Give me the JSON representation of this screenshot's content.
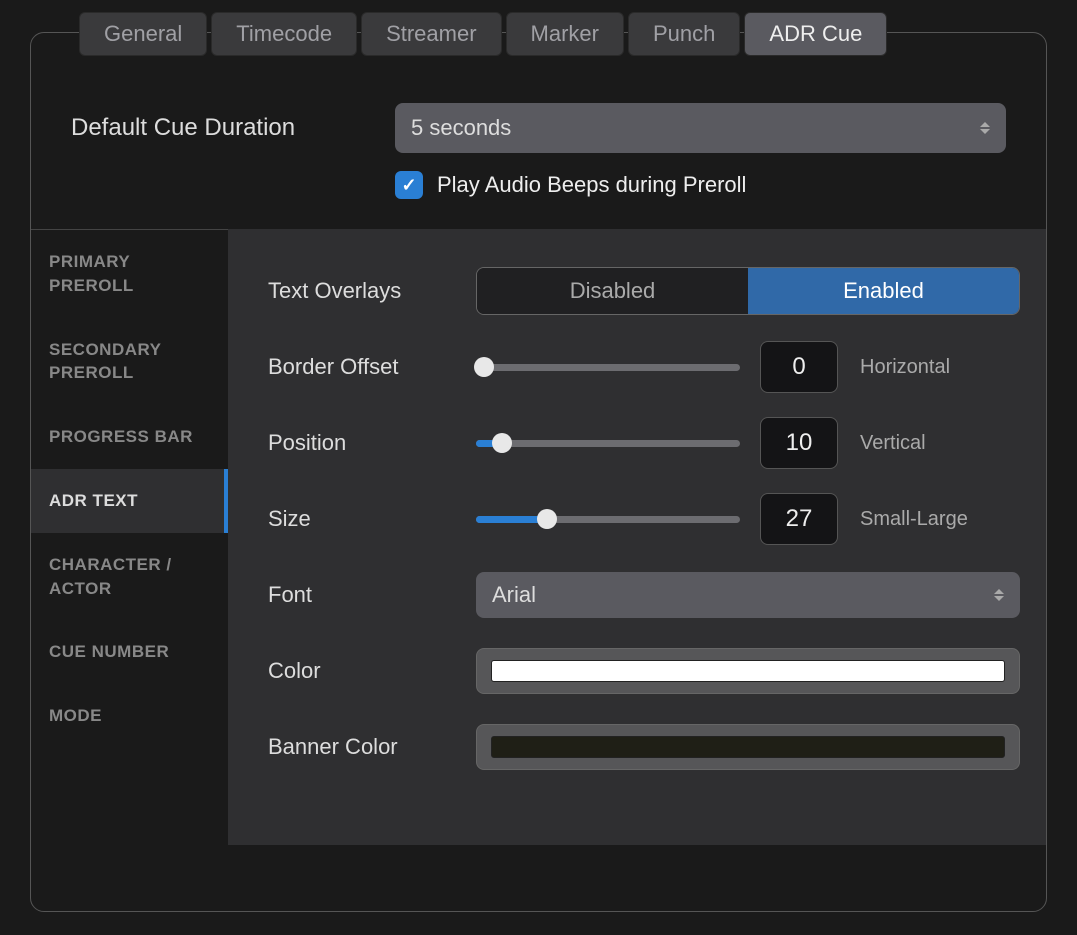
{
  "tabs": [
    {
      "label": "General",
      "active": false
    },
    {
      "label": "Timecode",
      "active": false
    },
    {
      "label": "Streamer",
      "active": false
    },
    {
      "label": "Marker",
      "active": false
    },
    {
      "label": "Punch",
      "active": false
    },
    {
      "label": "ADR Cue",
      "active": true
    }
  ],
  "default_cue_duration": {
    "label": "Default Cue Duration",
    "value": "5 seconds"
  },
  "play_beeps": {
    "label": "Play Audio Beeps during Preroll",
    "checked": true
  },
  "sidebar": [
    {
      "label": "PRIMARY PREROLL",
      "active": false
    },
    {
      "label": "SECONDARY PREROLL",
      "active": false
    },
    {
      "label": "PROGRESS BAR",
      "active": false
    },
    {
      "label": "ADR TEXT",
      "active": true
    },
    {
      "label": "CHARACTER / ACTOR",
      "active": false
    },
    {
      "label": "CUE NUMBER",
      "active": false
    },
    {
      "label": "MODE",
      "active": false
    }
  ],
  "detail": {
    "text_overlays": {
      "label": "Text Overlays",
      "options": [
        "Disabled",
        "Enabled"
      ],
      "selected": "Enabled"
    },
    "border_offset": {
      "label": "Border Offset",
      "value": 0,
      "min": 0,
      "max": 100,
      "suffix": "Horizontal"
    },
    "position": {
      "label": "Position",
      "value": 10,
      "min": 0,
      "max": 100,
      "suffix": "Vertical"
    },
    "size": {
      "label": "Size",
      "value": 27,
      "min": 0,
      "max": 100,
      "suffix": "Small-Large"
    },
    "font": {
      "label": "Font",
      "value": "Arial"
    },
    "color": {
      "label": "Color",
      "value": "#ffffff"
    },
    "banner_color": {
      "label": "Banner Color",
      "value": "#1f1f16"
    }
  }
}
